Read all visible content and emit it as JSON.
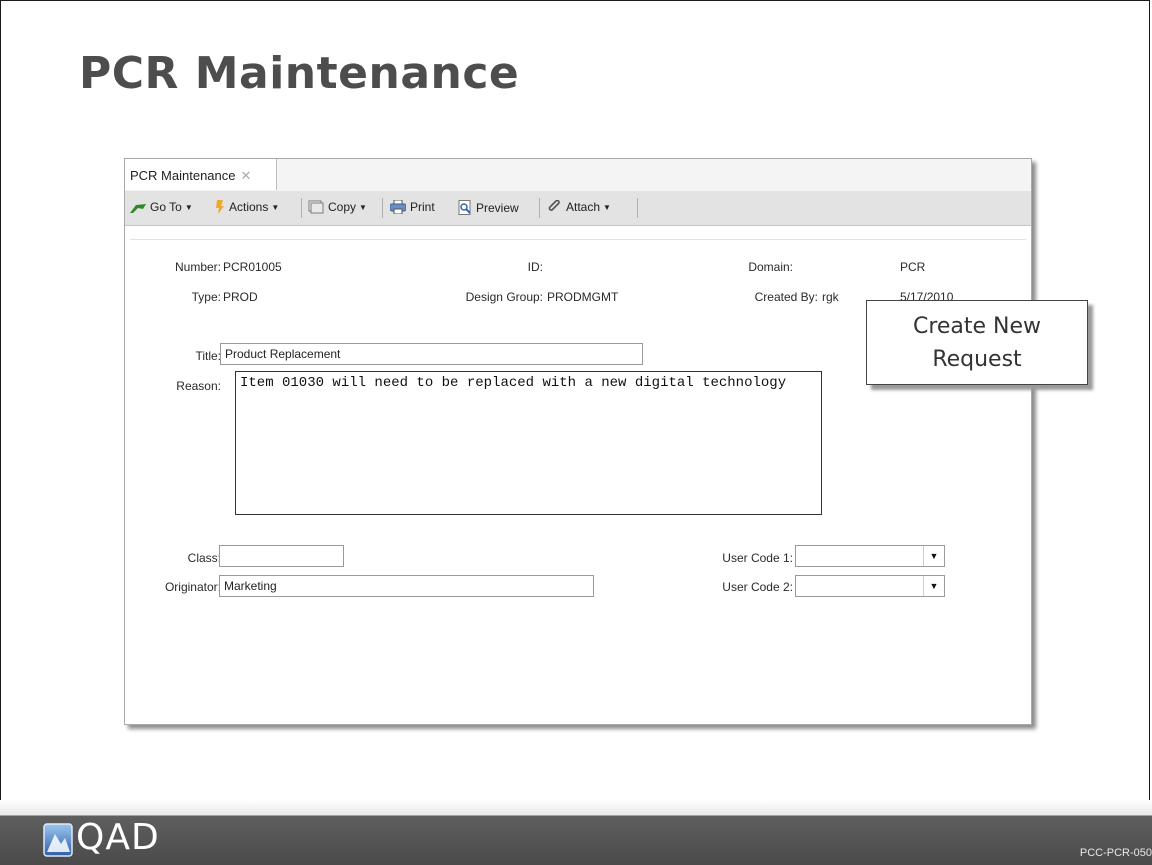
{
  "slide": {
    "title": "PCR Maintenance",
    "footer_code": "PCC-PCR-050",
    "logo_text": "QAD"
  },
  "window": {
    "tab": {
      "label": "PCR Maintenance",
      "close": "✕"
    },
    "toolbar": {
      "goto": "Go To",
      "actions": "Actions",
      "copy": "Copy",
      "print": "Print",
      "preview": "Preview",
      "attach": "Attach"
    },
    "header": {
      "number_label": "Number:",
      "number": "PCR01005",
      "id_label": "ID:",
      "domain_label": "Domain:",
      "domain": "PCR",
      "type_label": "Type:",
      "type": "PROD",
      "design_group_label": "Design Group:",
      "design_group": "PRODMGMT",
      "created_by_label": "Created By:",
      "created_by": "rgk",
      "date": "5/17/2010"
    },
    "form": {
      "title_label": "Title:",
      "title": "Product Replacement",
      "reason_label": "Reason:",
      "reason": "Item 01030 will need to be replaced with a new digital technology",
      "class_label": "Class:",
      "class": "",
      "originator_label": "Originator:",
      "originator": "Marketing",
      "user_code1_label": "User Code 1:",
      "user_code1": "",
      "user_code2_label": "User Code 2:",
      "user_code2": ""
    }
  },
  "callout": {
    "line1": "Create New",
    "line2": "Request"
  }
}
